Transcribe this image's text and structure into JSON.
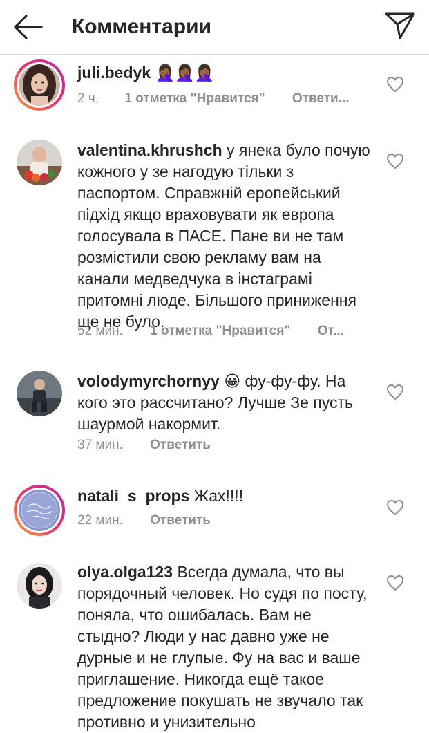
{
  "header": {
    "title": "Комментарии",
    "back_icon": "arrow-left-icon",
    "send_icon": "paper-plane-icon"
  },
  "comments": [
    {
      "username": "juli.bedyk",
      "text": "🤦🏾‍♀️🤦🏾‍♀️🤦🏾‍♀️",
      "time": "2 ч.",
      "likes": "1 отметка \"Нравится\"",
      "reply": "Ответи..."
    },
    {
      "username": "valentina.khrushch",
      "text": "у янека було почую кожного у зе нагодую тільки з паспортом. Справжній еропейський підхід якщо враховувати як европа голосувала в ПАСЕ. Пане ви не там розмістили свою рекламу вам на канали медведчука в інстаграмі притомні люде. Більшого приниження ще не було.",
      "time": "52 мин.",
      "likes": "1 отметка \"Нравится\"",
      "reply": "От..."
    },
    {
      "username": "volodymyrchornyy",
      "text": "😀 фу-фу-фу. На кого это рассчитано? Лучше Зе пусть шаурмой накормит.",
      "time": "37 мин.",
      "reply": "Ответить"
    },
    {
      "username": "natali_s_props",
      "text": "Жах!!!!",
      "time": "22 мин.",
      "reply": "Ответить"
    },
    {
      "username": "olya.olga123",
      "text": "Всегда думала, что вы порядочный человек. Но судя по посту, поняла,  что ошибалась. Вам не стыдно? Люди у нас давно уже не дурные и не глупые. Фу на вас и ваше приглашение. Никогда ещё такое предложение покушать не звучало так противно и унизительно"
    }
  ],
  "colors": {
    "text": "#262626",
    "muted": "#8e8e8e",
    "divider": "#dbdbdb",
    "story_ring_start": "#f9a23a",
    "story_ring_end": "#b52ca9"
  }
}
